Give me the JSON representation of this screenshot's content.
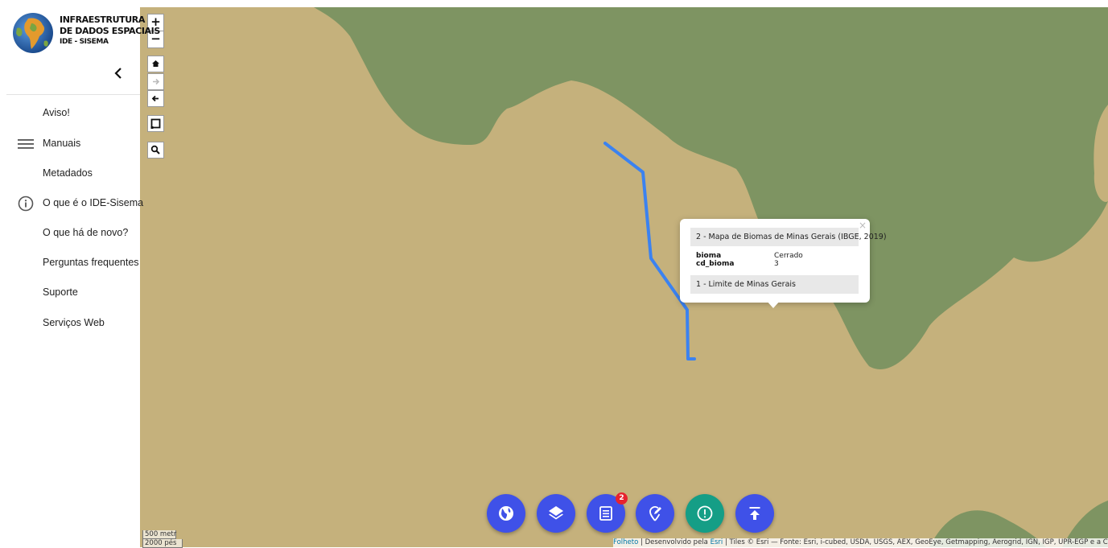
{
  "brand": {
    "line1": "INFRAESTRUTURA",
    "line2": "DE DADOS ESPACIAIS",
    "line3": "IDE - SISEMA"
  },
  "sidebar": {
    "items": [
      {
        "label": "Aviso!",
        "icon": ""
      },
      {
        "label": "Manuais",
        "icon": "menu-icon"
      },
      {
        "label": "Metadados",
        "icon": ""
      },
      {
        "label": "O que é o IDE-Sisema",
        "icon": "info-icon"
      },
      {
        "label": "O que há de novo?",
        "icon": ""
      },
      {
        "label": "Perguntas frequentes",
        "icon": ""
      },
      {
        "label": "Suporte",
        "icon": ""
      },
      {
        "label": "Serviços Web",
        "icon": ""
      }
    ]
  },
  "map_controls": {
    "zoom_in": "+",
    "zoom_out": "−",
    "home": "home-icon",
    "next_view": "arrow-right-icon",
    "prev_view": "arrow-left-icon",
    "box_select": "box-select-icon",
    "search": "search-icon"
  },
  "popup": {
    "close": "×",
    "layer2_title": "2 - Mapa de Biomas de Minas Gerais (IBGE, 2019)",
    "attributes": [
      {
        "key": "bioma",
        "value": "Cerrado"
      },
      {
        "key": "cd_bioma",
        "value": "3"
      }
    ],
    "layer1_title": "1 - Limite de Minas Gerais"
  },
  "toolbar": {
    "buttons": [
      "globe-icon",
      "layers-icon",
      "legend-list-icon",
      "edit-marker-icon",
      "alert-icon",
      "upload-icon"
    ],
    "badge_count": "2"
  },
  "scale": {
    "metric": "500 metr",
    "imperial": "2000 pés"
  },
  "attribution": {
    "leaflet": "Folheto",
    "developed": " | Desenvolvido pela ",
    "esri": "Esri",
    "tiles": " | Tiles © Esri — Fonte: Esri, i-cubed, USDA, USGS, AEX, GeoEye, Getmapping, Aerogrid, IGN, IGP, UPR-EGP e a Comunidade de Usuários GIS"
  },
  "colors": {
    "cerrado": "#c5b17c",
    "mata_atlantica": "#7e9462",
    "route": "#3b82f0",
    "fab": "#3f51e8",
    "fab_info": "#159e86",
    "badge": "#e7222e"
  }
}
